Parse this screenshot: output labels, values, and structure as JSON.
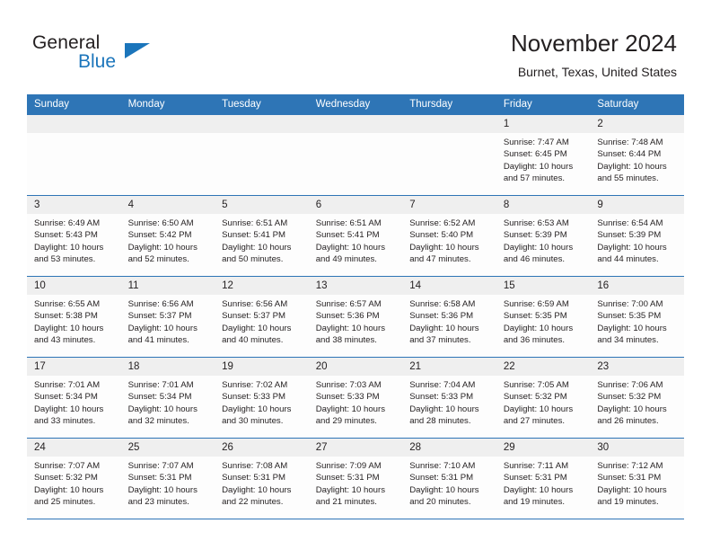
{
  "brand": {
    "name_part1": "General",
    "name_part2": "Blue",
    "accent_color": "#1b75bb"
  },
  "header": {
    "title": "November 2024",
    "subtitle": "Burnet, Texas, United States"
  },
  "theme": {
    "header_row_color": "#2e75b6",
    "daynum_band_color": "#efefef",
    "cell_background": "#fdfdfd",
    "text_color": "#231f20"
  },
  "labels": {
    "sunrise_prefix": "Sunrise:",
    "sunset_prefix": "Sunset:",
    "daylight_prefix": "Daylight:"
  },
  "weekdays": [
    "Sunday",
    "Monday",
    "Tuesday",
    "Wednesday",
    "Thursday",
    "Friday",
    "Saturday"
  ],
  "weeks": [
    [
      {
        "day": "",
        "sunrise": "",
        "sunset": "",
        "daylight_line1": "",
        "daylight_line2": ""
      },
      {
        "day": "",
        "sunrise": "",
        "sunset": "",
        "daylight_line1": "",
        "daylight_line2": ""
      },
      {
        "day": "",
        "sunrise": "",
        "sunset": "",
        "daylight_line1": "",
        "daylight_line2": ""
      },
      {
        "day": "",
        "sunrise": "",
        "sunset": "",
        "daylight_line1": "",
        "daylight_line2": ""
      },
      {
        "day": "",
        "sunrise": "",
        "sunset": "",
        "daylight_line1": "",
        "daylight_line2": ""
      },
      {
        "day": "1",
        "sunrise": "Sunrise: 7:47 AM",
        "sunset": "Sunset: 6:45 PM",
        "daylight_line1": "Daylight: 10 hours",
        "daylight_line2": "and 57 minutes."
      },
      {
        "day": "2",
        "sunrise": "Sunrise: 7:48 AM",
        "sunset": "Sunset: 6:44 PM",
        "daylight_line1": "Daylight: 10 hours",
        "daylight_line2": "and 55 minutes."
      }
    ],
    [
      {
        "day": "3",
        "sunrise": "Sunrise: 6:49 AM",
        "sunset": "Sunset: 5:43 PM",
        "daylight_line1": "Daylight: 10 hours",
        "daylight_line2": "and 53 minutes."
      },
      {
        "day": "4",
        "sunrise": "Sunrise: 6:50 AM",
        "sunset": "Sunset: 5:42 PM",
        "daylight_line1": "Daylight: 10 hours",
        "daylight_line2": "and 52 minutes."
      },
      {
        "day": "5",
        "sunrise": "Sunrise: 6:51 AM",
        "sunset": "Sunset: 5:41 PM",
        "daylight_line1": "Daylight: 10 hours",
        "daylight_line2": "and 50 minutes."
      },
      {
        "day": "6",
        "sunrise": "Sunrise: 6:51 AM",
        "sunset": "Sunset: 5:41 PM",
        "daylight_line1": "Daylight: 10 hours",
        "daylight_line2": "and 49 minutes."
      },
      {
        "day": "7",
        "sunrise": "Sunrise: 6:52 AM",
        "sunset": "Sunset: 5:40 PM",
        "daylight_line1": "Daylight: 10 hours",
        "daylight_line2": "and 47 minutes."
      },
      {
        "day": "8",
        "sunrise": "Sunrise: 6:53 AM",
        "sunset": "Sunset: 5:39 PM",
        "daylight_line1": "Daylight: 10 hours",
        "daylight_line2": "and 46 minutes."
      },
      {
        "day": "9",
        "sunrise": "Sunrise: 6:54 AM",
        "sunset": "Sunset: 5:39 PM",
        "daylight_line1": "Daylight: 10 hours",
        "daylight_line2": "and 44 minutes."
      }
    ],
    [
      {
        "day": "10",
        "sunrise": "Sunrise: 6:55 AM",
        "sunset": "Sunset: 5:38 PM",
        "daylight_line1": "Daylight: 10 hours",
        "daylight_line2": "and 43 minutes."
      },
      {
        "day": "11",
        "sunrise": "Sunrise: 6:56 AM",
        "sunset": "Sunset: 5:37 PM",
        "daylight_line1": "Daylight: 10 hours",
        "daylight_line2": "and 41 minutes."
      },
      {
        "day": "12",
        "sunrise": "Sunrise: 6:56 AM",
        "sunset": "Sunset: 5:37 PM",
        "daylight_line1": "Daylight: 10 hours",
        "daylight_line2": "and 40 minutes."
      },
      {
        "day": "13",
        "sunrise": "Sunrise: 6:57 AM",
        "sunset": "Sunset: 5:36 PM",
        "daylight_line1": "Daylight: 10 hours",
        "daylight_line2": "and 38 minutes."
      },
      {
        "day": "14",
        "sunrise": "Sunrise: 6:58 AM",
        "sunset": "Sunset: 5:36 PM",
        "daylight_line1": "Daylight: 10 hours",
        "daylight_line2": "and 37 minutes."
      },
      {
        "day": "15",
        "sunrise": "Sunrise: 6:59 AM",
        "sunset": "Sunset: 5:35 PM",
        "daylight_line1": "Daylight: 10 hours",
        "daylight_line2": "and 36 minutes."
      },
      {
        "day": "16",
        "sunrise": "Sunrise: 7:00 AM",
        "sunset": "Sunset: 5:35 PM",
        "daylight_line1": "Daylight: 10 hours",
        "daylight_line2": "and 34 minutes."
      }
    ],
    [
      {
        "day": "17",
        "sunrise": "Sunrise: 7:01 AM",
        "sunset": "Sunset: 5:34 PM",
        "daylight_line1": "Daylight: 10 hours",
        "daylight_line2": "and 33 minutes."
      },
      {
        "day": "18",
        "sunrise": "Sunrise: 7:01 AM",
        "sunset": "Sunset: 5:34 PM",
        "daylight_line1": "Daylight: 10 hours",
        "daylight_line2": "and 32 minutes."
      },
      {
        "day": "19",
        "sunrise": "Sunrise: 7:02 AM",
        "sunset": "Sunset: 5:33 PM",
        "daylight_line1": "Daylight: 10 hours",
        "daylight_line2": "and 30 minutes."
      },
      {
        "day": "20",
        "sunrise": "Sunrise: 7:03 AM",
        "sunset": "Sunset: 5:33 PM",
        "daylight_line1": "Daylight: 10 hours",
        "daylight_line2": "and 29 minutes."
      },
      {
        "day": "21",
        "sunrise": "Sunrise: 7:04 AM",
        "sunset": "Sunset: 5:33 PM",
        "daylight_line1": "Daylight: 10 hours",
        "daylight_line2": "and 28 minutes."
      },
      {
        "day": "22",
        "sunrise": "Sunrise: 7:05 AM",
        "sunset": "Sunset: 5:32 PM",
        "daylight_line1": "Daylight: 10 hours",
        "daylight_line2": "and 27 minutes."
      },
      {
        "day": "23",
        "sunrise": "Sunrise: 7:06 AM",
        "sunset": "Sunset: 5:32 PM",
        "daylight_line1": "Daylight: 10 hours",
        "daylight_line2": "and 26 minutes."
      }
    ],
    [
      {
        "day": "24",
        "sunrise": "Sunrise: 7:07 AM",
        "sunset": "Sunset: 5:32 PM",
        "daylight_line1": "Daylight: 10 hours",
        "daylight_line2": "and 25 minutes."
      },
      {
        "day": "25",
        "sunrise": "Sunrise: 7:07 AM",
        "sunset": "Sunset: 5:31 PM",
        "daylight_line1": "Daylight: 10 hours",
        "daylight_line2": "and 23 minutes."
      },
      {
        "day": "26",
        "sunrise": "Sunrise: 7:08 AM",
        "sunset": "Sunset: 5:31 PM",
        "daylight_line1": "Daylight: 10 hours",
        "daylight_line2": "and 22 minutes."
      },
      {
        "day": "27",
        "sunrise": "Sunrise: 7:09 AM",
        "sunset": "Sunset: 5:31 PM",
        "daylight_line1": "Daylight: 10 hours",
        "daylight_line2": "and 21 minutes."
      },
      {
        "day": "28",
        "sunrise": "Sunrise: 7:10 AM",
        "sunset": "Sunset: 5:31 PM",
        "daylight_line1": "Daylight: 10 hours",
        "daylight_line2": "and 20 minutes."
      },
      {
        "day": "29",
        "sunrise": "Sunrise: 7:11 AM",
        "sunset": "Sunset: 5:31 PM",
        "daylight_line1": "Daylight: 10 hours",
        "daylight_line2": "and 19 minutes."
      },
      {
        "day": "30",
        "sunrise": "Sunrise: 7:12 AM",
        "sunset": "Sunset: 5:31 PM",
        "daylight_line1": "Daylight: 10 hours",
        "daylight_line2": "and 19 minutes."
      }
    ]
  ]
}
